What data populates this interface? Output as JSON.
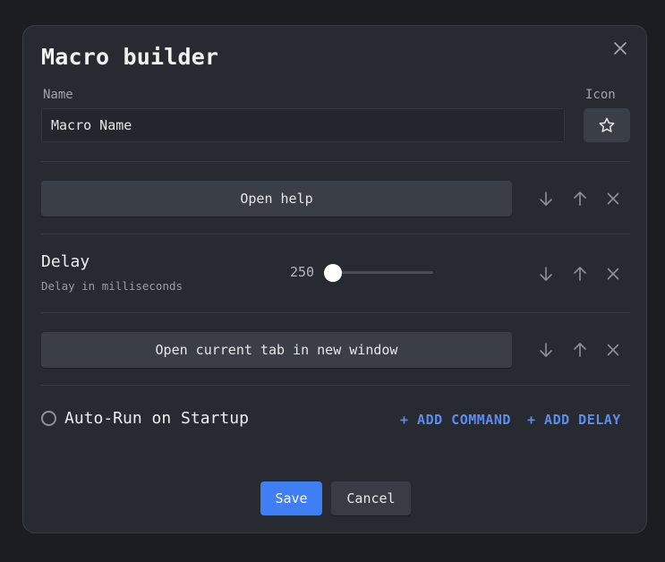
{
  "dialog": {
    "title": "Macro builder",
    "name_label": "Name",
    "icon_label": "Icon",
    "name_value": "Macro Name",
    "icon": "star-icon"
  },
  "steps": [
    {
      "type": "command",
      "label": "Open help"
    },
    {
      "type": "delay",
      "title": "Delay",
      "subtitle": "Delay in milliseconds",
      "value": "250",
      "slider_fraction": 0.0
    },
    {
      "type": "command",
      "label": "Open current tab in new window"
    }
  ],
  "options": {
    "autorun_label": "Auto-Run on Startup",
    "autorun_checked": false
  },
  "actions": {
    "add_command": "+ ADD COMMAND",
    "add_delay": "+ ADD DELAY",
    "save": "Save",
    "cancel": "Cancel"
  },
  "colors": {
    "accent": "#3f7ff3",
    "link": "#5b8cf0",
    "background": "#272a31"
  }
}
